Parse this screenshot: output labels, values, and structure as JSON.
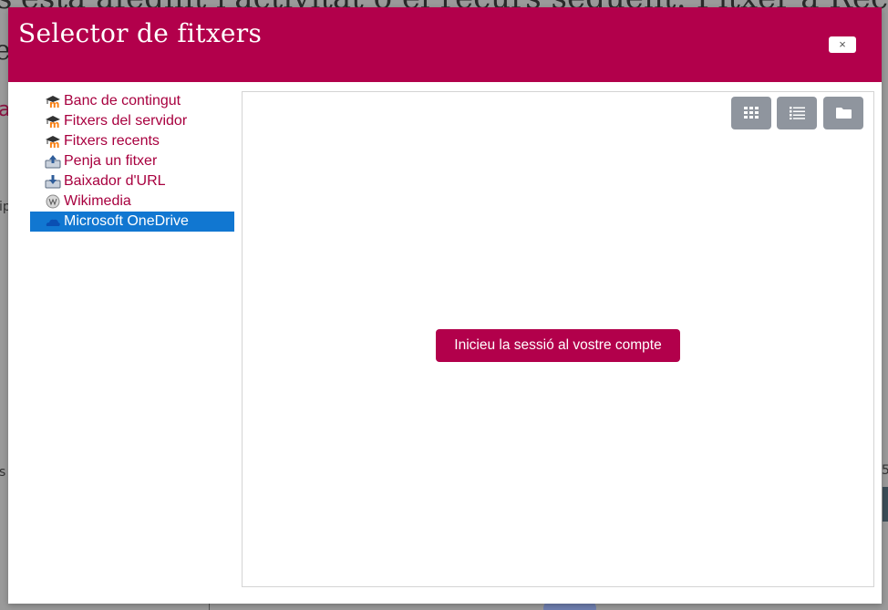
{
  "background": {
    "title_fragment": "s'està afegint l'activitat o el recurs següent: Fitxer a Recursos",
    "title_fragment_2": "e",
    "left_letter": "a",
    "left_fragment_mid": "ip",
    "left_fragment_low": "s",
    "right_fragment": "5"
  },
  "dialog": {
    "title": "Selector de fitxers",
    "close_label": "×",
    "header_color": "#b2004b"
  },
  "repositories": {
    "items": [
      {
        "label": "Banc de contingut",
        "icon": "moodle-icon",
        "selected": false
      },
      {
        "label": "Fitxers del servidor",
        "icon": "moodle-icon",
        "selected": false
      },
      {
        "label": "Fitxers recents",
        "icon": "moodle-icon",
        "selected": false
      },
      {
        "label": "Penja un fitxer",
        "icon": "upload-icon",
        "selected": false
      },
      {
        "label": "Baixador d'URL",
        "icon": "url-download-icon",
        "selected": false
      },
      {
        "label": "Wikimedia",
        "icon": "wikimedia-icon",
        "selected": false
      },
      {
        "label": "Microsoft OneDrive",
        "icon": "onedrive-icon",
        "selected": true
      }
    ],
    "selected_color": "#1177d1",
    "link_color": "#a8003f"
  },
  "toolbar": {
    "views": [
      {
        "icon": "grid-view-icon"
      },
      {
        "icon": "list-view-icon"
      },
      {
        "icon": "folder-view-icon"
      }
    ],
    "button_color": "#8f959e"
  },
  "content": {
    "login_button": "Inicieu la sessió al vostre compte"
  }
}
